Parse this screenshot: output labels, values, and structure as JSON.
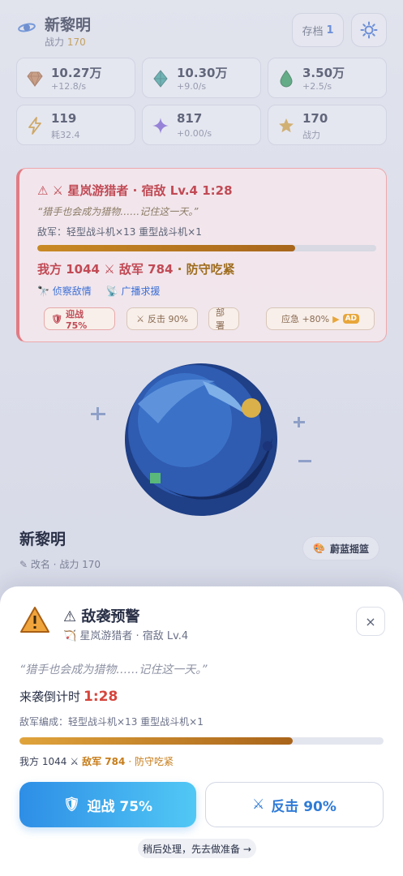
{
  "header": {
    "title": "新黎明",
    "power_label": "战力",
    "power_value": "170",
    "save_label": "存档",
    "save_slot": "1"
  },
  "resources": [
    {
      "icon": "diamond-icon",
      "value": "10.27万",
      "sub": "+12.8/s"
    },
    {
      "icon": "crystal-icon",
      "value": "10.30万",
      "sub": "+9.0/s"
    },
    {
      "icon": "drop-icon",
      "value": "3.50万",
      "sub": "+2.5/s"
    },
    {
      "icon": "lightning-icon",
      "value": "119",
      "sub": "耗32.4"
    },
    {
      "icon": "sparkle-icon",
      "value": "817",
      "sub": "+0.00/s"
    },
    {
      "icon": "star-icon",
      "value": "170",
      "sub": "战力"
    }
  ],
  "alert_card": {
    "title": "星岚游猎者 · 宿敌 Lv.4 1:28",
    "quote": "“猎手也会成为猎物……记住这一天。”",
    "enemy": "敌军：轻型战斗机×13 重型战斗机×1",
    "progress": 0.76,
    "our_side": "我方 1044",
    "enemy_side": "敌军 784",
    "verdict": "· 防守吃紧",
    "action_scout": "侦察敌情",
    "action_broadcast": "广播求援",
    "chip_fight": "迎战 75%",
    "chip_counter": "反击 90%",
    "chip_deploy": "部署",
    "chip_emergency": "应急 +80%",
    "chip_ad": "AD"
  },
  "planet": {
    "name": "新黎明",
    "sub": "✎ 改名 · 战力 170",
    "biome": "蔚蓝摇篮"
  },
  "sheet": {
    "title": "⚠ 敌袭预警",
    "subtitle": "星岚游猎者 · 宿敌 Lv.4",
    "quote": "“猎手也会成为猎物……记住这一天。”",
    "countdown_label": "来袭倒计时",
    "countdown_time": "1:28",
    "composition": "敌军编成：轻型战斗机×13 重型战斗机×1",
    "progress": 0.75,
    "our_side": "我方 1044",
    "enemy_side": "敌军 784",
    "verdict": "· 防守吃紧",
    "fight_label": "迎战 75%",
    "counter_label": "反击 90%",
    "later_label": "稍后处理，先去做准备 →",
    "close_label": "×"
  },
  "colors": {
    "accent_blue": "#2e8ee6",
    "danger_red": "#d6453c",
    "warning_orange": "#c77d1a"
  }
}
